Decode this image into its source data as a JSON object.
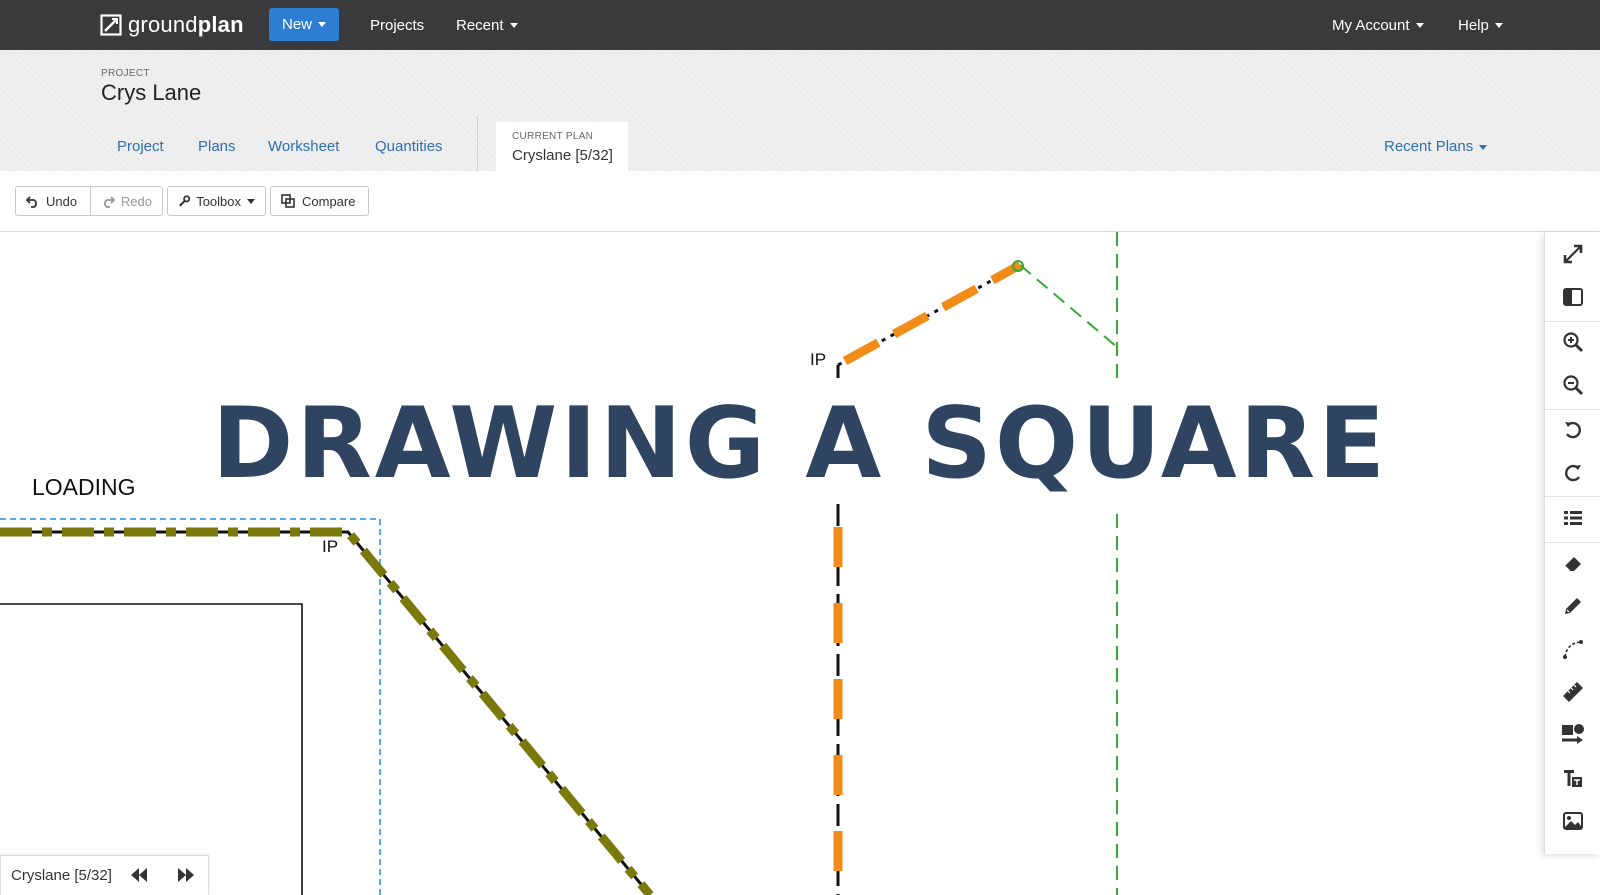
{
  "navbar": {
    "brand_light": "ground",
    "brand_bold": "plan",
    "new_label": "New",
    "projects_label": "Projects",
    "recent_label": "Recent",
    "account_label": "My Account",
    "help_label": "Help"
  },
  "project": {
    "label": "PROJECT",
    "name": "Crys Lane"
  },
  "tabs": [
    {
      "label": "Project"
    },
    {
      "label": "Plans"
    },
    {
      "label": "Worksheet"
    },
    {
      "label": "Quantities"
    }
  ],
  "current_plan": {
    "label": "CURRENT PLAN",
    "name": "Cryslane [5/32]"
  },
  "recent_plans_label": "Recent Plans",
  "toolbar": {
    "undo_label": "Undo",
    "redo_label": "Redo",
    "toolbox_label": "Toolbox",
    "compare_label": "Compare"
  },
  "canvas": {
    "overlay_title": "DRAWING A SQUARE",
    "loading_label": "LOADING",
    "ip_label_top": "IP",
    "ip_label_left": "IP"
  },
  "palette": {
    "icons": [
      "expand-icon",
      "split-view-icon",
      "zoom-in-icon",
      "zoom-out-icon",
      "rotate-left-icon",
      "rotate-right-icon",
      "list-icon",
      "eraser-icon",
      "pencil-icon",
      "curve-icon",
      "ruler-icon",
      "shapes-icon",
      "text-icon",
      "image-icon"
    ]
  },
  "pager": {
    "plan_name": "Cryslane [5/32]"
  },
  "colors": {
    "navbar": "#3a3a3c",
    "primary": "#2d7dd2",
    "link": "#2f6fb0",
    "overlay_title": "#2e4461",
    "line_orange": "#f28c18",
    "line_olive": "#7a7a0c",
    "line_green": "#3aa83a",
    "line_blue_dashed": "#5aa9e6"
  }
}
